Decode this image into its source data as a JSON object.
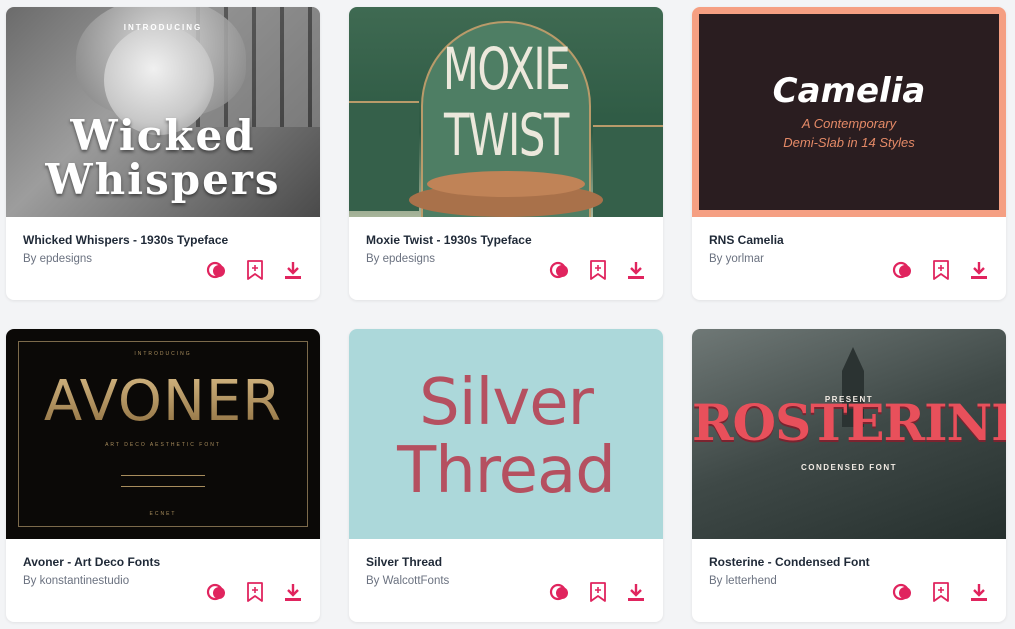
{
  "cards": [
    {
      "title": "Whicked Whispers - 1930s Typeface",
      "author": "By epdesigns",
      "thumb": {
        "intro": "INTRODUCING",
        "line1": "Wicked",
        "line2": "Whispers"
      }
    },
    {
      "title": "Moxie Twist - 1930s Typeface",
      "author": "By epdesigns",
      "thumb": {
        "line1": "MOXIE",
        "line2": "TWIST"
      }
    },
    {
      "title": "RNS Camelia",
      "author": "By yorlmar",
      "thumb": {
        "line1": "Camelia",
        "line2": "A Contemporary",
        "line3": "Demi-Slab in 14 Styles"
      }
    },
    {
      "title": "Avoner - Art Deco Fonts",
      "author": "By konstantinestudio",
      "thumb": {
        "intro": "INTRODUCING",
        "line1": "AVONER",
        "line2": "ART DECO AESTHETIC FONT",
        "footer": "ECNET"
      }
    },
    {
      "title": "Silver Thread",
      "author": "By WalcottFonts",
      "thumb": {
        "line1": "Silver",
        "line2": "Thread"
      }
    },
    {
      "title": "Rosterine - Condensed Font",
      "author": "By letterhend",
      "thumb": {
        "intro": "PRESENT",
        "line1": "ROSTERINE",
        "line2": "CONDENSED FONT"
      }
    }
  ],
  "icons": {
    "compare": "overlap-circles-icon",
    "bookmark": "bookmark-plus-icon",
    "download": "download-icon"
  },
  "colors": {
    "accent": "#e0245e"
  }
}
